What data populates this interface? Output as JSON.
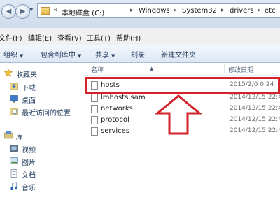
{
  "address": {
    "crumbs": [
      "本地磁盘 (C:)",
      "Windows",
      "System32",
      "drivers",
      "etc"
    ],
    "overflow": "«"
  },
  "menu": [
    "文件(F)",
    "编辑(E)",
    "查看(V)",
    "工具(T)",
    "帮助(H)"
  ],
  "toolbar": {
    "organize": "组织",
    "include": "包含到库中",
    "share": "共享",
    "burn": "刻录",
    "new_folder": "新建文件夹"
  },
  "sidebar": {
    "favorites": "收藏夹",
    "favorites_items": [
      "下载",
      "桌面",
      "最近访问的位置"
    ],
    "libraries": "库",
    "libraries_items": [
      "视频",
      "图片",
      "文档",
      "音乐"
    ]
  },
  "columns": {
    "name": "名称",
    "modified": "修改日期"
  },
  "files": [
    {
      "name": "hosts",
      "date": "2015/2/6 0:24"
    },
    {
      "name": "lmhosts.sam",
      "date": "2014/12/15 22:4"
    },
    {
      "name": "networks",
      "date": "2014/12/15 22:4"
    },
    {
      "name": "protocol",
      "date": "2014/12/15 22:4"
    },
    {
      "name": "services",
      "date": "2014/12/15 22:4"
    }
  ],
  "colors": {
    "highlight": "#d2232a",
    "toolbar_text": "#1e395b"
  }
}
